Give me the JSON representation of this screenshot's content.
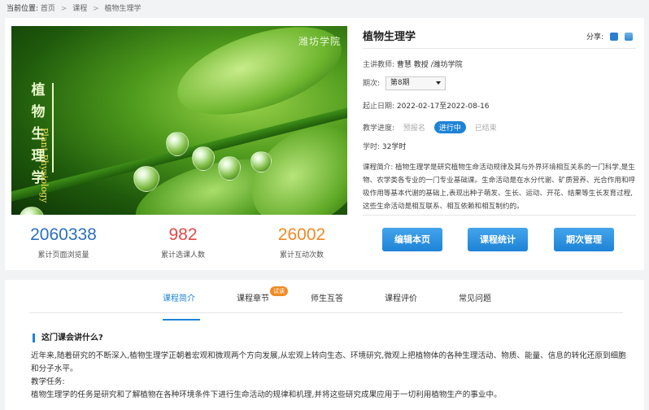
{
  "breadcrumb": {
    "label": "当前位置:",
    "items": [
      "首页",
      "课程",
      "植物生理学"
    ]
  },
  "cover": {
    "title_vertical": "植物生理学",
    "title_english": "Plant Physiology",
    "logo_text": "潍坊学院"
  },
  "course": {
    "title": "植物生理学",
    "share_label": "分享:",
    "teacher_label": "主讲教师:",
    "teacher": "曹慧 教授 /潍坊学院",
    "term_label": "期次:",
    "term_selected": "第8期",
    "date_label": "起止日期:",
    "dates": "2022-02-17至2022-08-16",
    "progress_label": "教学进度:",
    "progress": [
      "预报名",
      "进行中",
      "已结束"
    ],
    "progress_active_index": 1,
    "hours_label": "学时:",
    "hours": "32学时",
    "intro_label": "课程简介:",
    "intro": "植物生理学是研究植物生命活动规律及其与外界环境相互关系的一门科学,是生物、农学类各专业的一门专业基础课。生命活动是在水分代谢、矿质营养、光合作用和呼吸作用等基本代谢的基础上,表现出种子萌发、生长、运动、开花、结果等生长发育过程,这些生命活动是相互联系、相互依赖和相互制约的。"
  },
  "stats": [
    {
      "value": "2060338",
      "label": "累计页面浏览量"
    },
    {
      "value": "982",
      "label": "累计选课人数"
    },
    {
      "value": "26002",
      "label": "累计互动次数"
    }
  ],
  "actions": {
    "edit": "编辑本页",
    "stats": "课程统计",
    "terms": "期次管理"
  },
  "tabs": {
    "items": [
      "课程简介",
      "课程章节",
      "师生互答",
      "课程评价",
      "常见问题"
    ],
    "active_index": 0,
    "badge": "试读"
  },
  "section": {
    "heading": "这门课会讲什么?",
    "p1": "近年来,随着研究的不断深入,植物生理学正朝着宏观和微观两个方向发展,从宏观上转向生态、环境研究,微观上把植物体的各种生理活动、物质、能量、信息的转化还原到细胞和分子水平。",
    "p2": "教学任务:",
    "p3": "植物生理学的任务是研究和了解植物在各种环境条件下进行生命活动的规律和机理,并将这些研究成果应用于一切利用植物生产的事业中。"
  },
  "colors": {
    "accent": "#1e83d6",
    "views": "#2c6fbf",
    "students": "#e24a47",
    "interactions": "#f08a24"
  }
}
